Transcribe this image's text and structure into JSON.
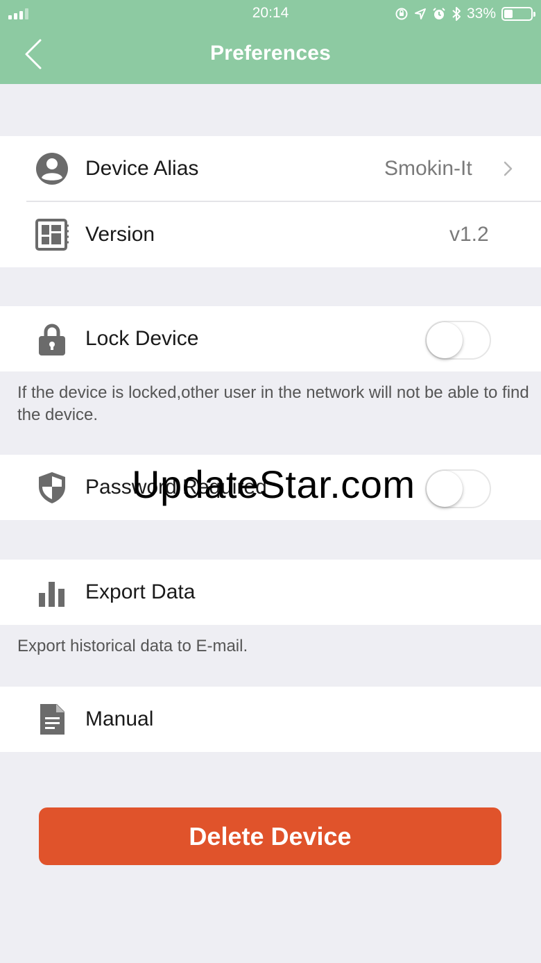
{
  "status_bar": {
    "time": "20:14",
    "battery_percent": "33%",
    "battery_level": 0.33
  },
  "nav": {
    "title": "Preferences",
    "back_icon": "chevron-left-icon"
  },
  "colors": {
    "header": "#8dcaa2",
    "delete": "#e0532b",
    "background": "#eeeef3"
  },
  "settings": {
    "device_alias": {
      "label": "Device Alias",
      "value": "Smokin-It",
      "icon": "user-circle-icon"
    },
    "version": {
      "label": "Version",
      "value": "v1.2",
      "icon": "chip-icon"
    },
    "lock_device": {
      "label": "Lock Device",
      "enabled": false,
      "icon": "lock-icon",
      "footnote": "If the device is locked,other user in the network will not be able to find the device."
    },
    "password_required": {
      "label": "Password Required",
      "enabled": false,
      "icon": "shield-icon"
    },
    "export_data": {
      "label": "Export Data",
      "icon": "bar-chart-icon",
      "footnote": "Export historical data to E-mail."
    },
    "manual": {
      "label": "Manual",
      "icon": "document-icon"
    }
  },
  "actions": {
    "delete_label": "Delete Device"
  },
  "watermark": "UpdateStar.com"
}
